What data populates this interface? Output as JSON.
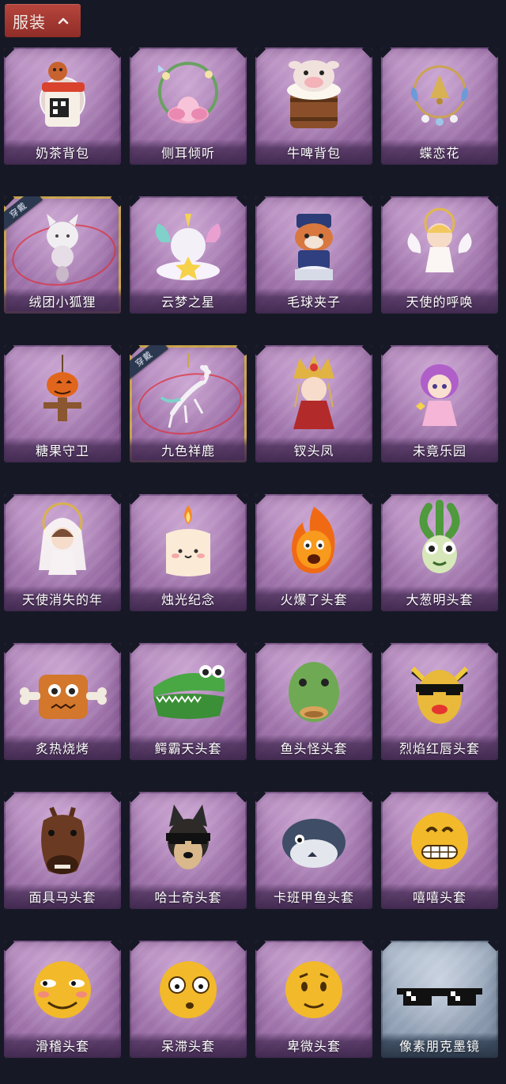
{
  "header": {
    "title": "服装",
    "toggle_icon": "chevron-up-icon"
  },
  "items": [
    {
      "label": "奶茶背包",
      "icon": "milk-tea-backpack-icon"
    },
    {
      "label": "侧耳倾听",
      "icon": "lotus-wreath-icon"
    },
    {
      "label": "牛啤背包",
      "icon": "cow-beer-barrel-icon"
    },
    {
      "label": "蝶恋花",
      "icon": "butterfly-bell-icon"
    },
    {
      "label": "绒团小狐狸",
      "icon": "fluffy-fox-icon",
      "badge": "穿戴"
    },
    {
      "label": "云梦之星",
      "icon": "unicorn-cloud-icon"
    },
    {
      "label": "毛球夹子",
      "icon": "raccoon-drummer-icon"
    },
    {
      "label": "天使的呼唤",
      "icon": "angel-icon"
    },
    {
      "label": "糖果守卫",
      "icon": "pumpkin-scarecrow-icon"
    },
    {
      "label": "九色祥鹿",
      "icon": "nine-color-deer-icon",
      "badge": "穿戴"
    },
    {
      "label": "钗头凤",
      "icon": "phoenix-crown-doll-icon"
    },
    {
      "label": "未竟乐园",
      "icon": "purple-hair-doll-icon"
    },
    {
      "label": "天使消失的年",
      "icon": "veiled-angel-doll-icon"
    },
    {
      "label": "烛光纪念",
      "icon": "candle-icon"
    },
    {
      "label": "火爆了头套",
      "icon": "fire-head-icon"
    },
    {
      "label": "大葱明头套",
      "icon": "scallion-head-icon"
    },
    {
      "label": "炙热烧烤",
      "icon": "bbq-meat-head-icon"
    },
    {
      "label": "鳄霸天头套",
      "icon": "crocodile-head-icon"
    },
    {
      "label": "鱼头怪头套",
      "icon": "fish-head-icon"
    },
    {
      "label": "烈焰红唇头套",
      "icon": "yellow-lips-head-icon"
    },
    {
      "label": "面具马头套",
      "icon": "horse-head-icon"
    },
    {
      "label": "哈士奇头套",
      "icon": "husky-head-icon"
    },
    {
      "label": "卡班甲鱼头套",
      "icon": "turtle-head-icon"
    },
    {
      "label": "嘻嘻头套",
      "icon": "grin-emoji-head-icon"
    },
    {
      "label": "滑稽头套",
      "icon": "funny-emoji-head-icon"
    },
    {
      "label": "呆滞头套",
      "icon": "dazed-emoji-head-icon"
    },
    {
      "label": "卑微头套",
      "icon": "humble-emoji-head-icon"
    },
    {
      "label": "像素朋克墨镜",
      "icon": "pixel-sunglasses-icon",
      "variant": "blue"
    }
  ],
  "colors": {
    "background": "#161925",
    "header": "#a33a33",
    "card_purple": "#a579b0",
    "card_blue": "#97a6ba",
    "equipped_border": "#c9a24e",
    "equipped_ring": "#dc323c"
  }
}
